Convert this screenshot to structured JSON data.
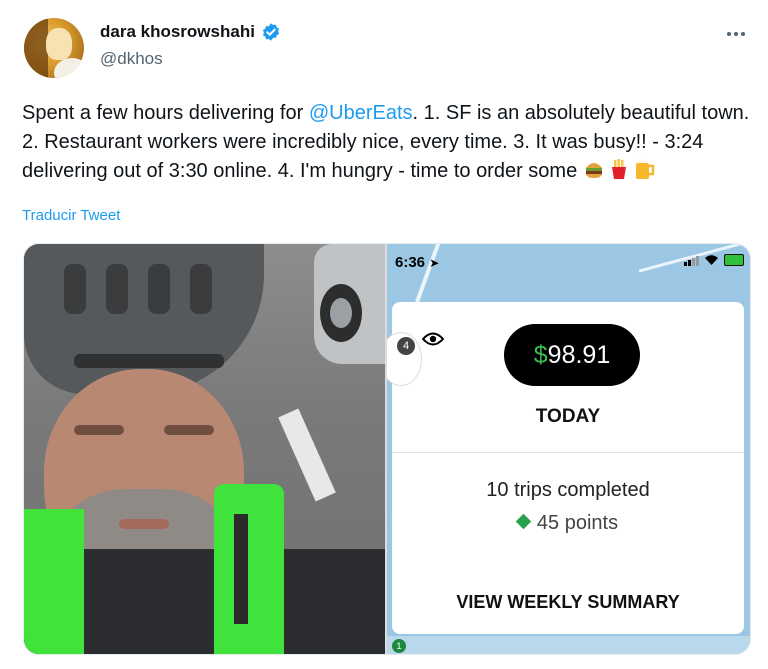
{
  "author": {
    "display_name": "dara khosrowshahi",
    "handle": "@dkhos",
    "verified": true
  },
  "tweet": {
    "text_before_mention": "Spent a few hours delivering for ",
    "mention": "@UberEats",
    "text_after_mention": ".  1. SF is an absolutely beautiful town.  2. Restaurant workers were incredibly nice, every time.  3. It was busy!! - 3:24 delivering out of 3:30 online.  4. I'm hungry - time to order some",
    "emojis": [
      "🍔",
      "🍟",
      "🍺"
    ],
    "translate_label": "Traducir Tweet"
  },
  "screenshot": {
    "status_time": "6:36",
    "rating_badge": "4",
    "earnings_dollar": "$",
    "earnings_amount": "98.91",
    "period": "TODAY",
    "trips": "10 trips completed",
    "points": "45 points",
    "summary_button": "VIEW WEEKLY SUMMARY",
    "map_pin": "1"
  },
  "icons": {
    "verified": "verified-badge-icon",
    "more": "more-options-icon",
    "eye": "eye-icon",
    "diamond": "diamond-icon"
  },
  "colors": {
    "link": "#1d9bf0",
    "verified": "#1d9bf0",
    "earnings_dollar": "#3ebc54",
    "points_diamond": "#2aa14b",
    "vest_green": "#41e33a"
  }
}
